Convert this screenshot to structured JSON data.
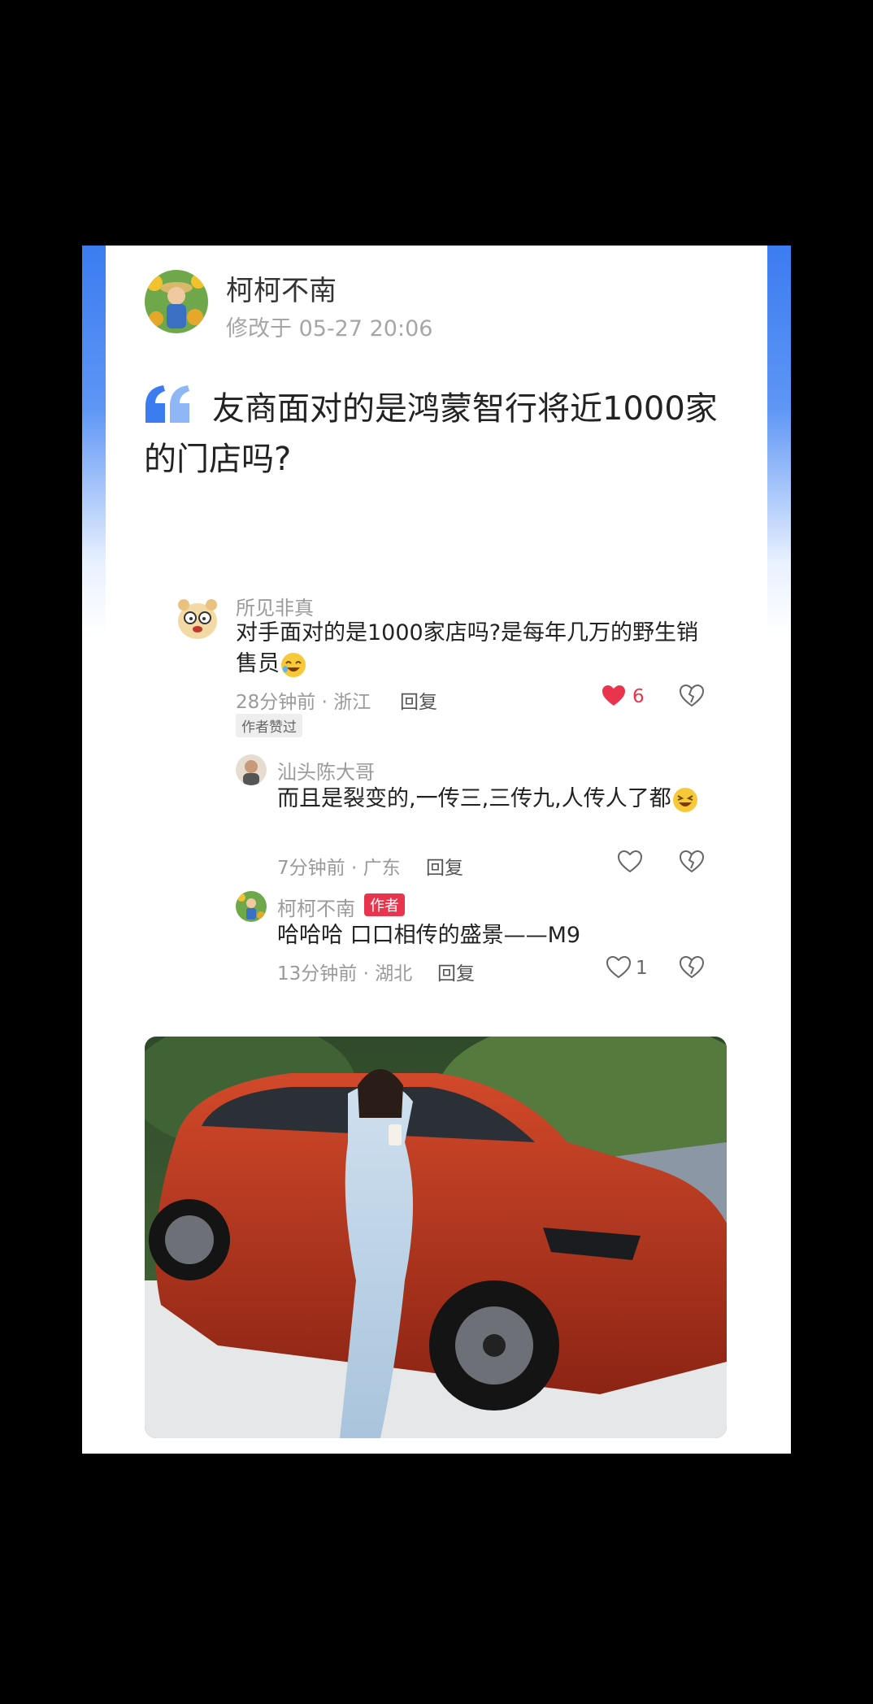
{
  "post": {
    "author": "柯柯不南",
    "modified": "修改于 05-27 20:06",
    "question": "友商面对的是鸿蒙智行将近1000家的门店吗?"
  },
  "comments": [
    {
      "user": "所见非真",
      "text": "对手面对的是1000家店吗?是每年几万的野生销售员",
      "meta": "28分钟前 · 浙江",
      "reply": "回复",
      "likes": "6",
      "liked": true,
      "badge": "作者赞过"
    },
    {
      "user": "汕头陈大哥",
      "text": "而且是裂变的,一传三,三传九,人传人了都",
      "meta": "7分钟前 · 广东",
      "reply": "回复",
      "likes": "",
      "liked": false
    },
    {
      "user": "柯柯不南",
      "tag": "作者",
      "text": "哈哈哈 口口相传的盛景——M9",
      "meta": "13分钟前 · 湖北",
      "reply": "回复",
      "likes": "1",
      "liked": false
    }
  ],
  "icons": {
    "like": "heart-icon",
    "dislike": "broken-heart-icon",
    "quote": "quote-icon"
  },
  "colors": {
    "accent_blue": "#3b7cf0",
    "like_red": "#e8354d",
    "author_tag": "#e8354d"
  }
}
